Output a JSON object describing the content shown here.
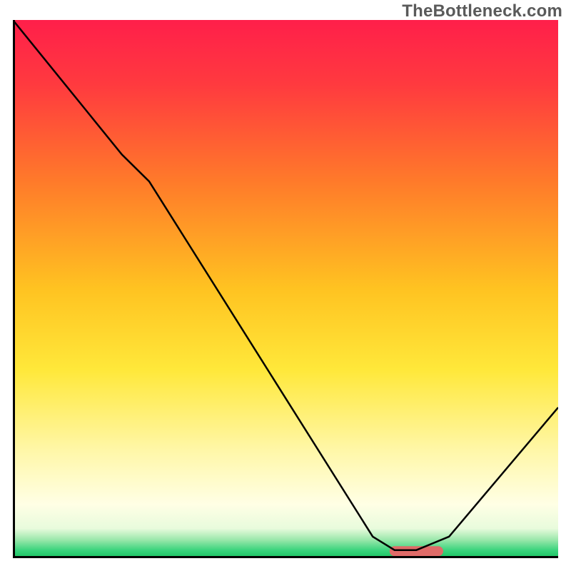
{
  "watermark": "TheBottleneck.com",
  "chart_data": {
    "type": "line",
    "title": "",
    "xlabel": "",
    "ylabel": "",
    "xlim": [
      0,
      100
    ],
    "ylim": [
      0,
      100
    ],
    "grid": false,
    "legend": null,
    "gradient_stops": [
      {
        "offset": 0.0,
        "color": "#ff1f4a"
      },
      {
        "offset": 0.12,
        "color": "#ff3a3f"
      },
      {
        "offset": 0.3,
        "color": "#ff7a2a"
      },
      {
        "offset": 0.5,
        "color": "#ffc321"
      },
      {
        "offset": 0.65,
        "color": "#ffe83a"
      },
      {
        "offset": 0.8,
        "color": "#fff7a8"
      },
      {
        "offset": 0.9,
        "color": "#ffffe5"
      },
      {
        "offset": 0.945,
        "color": "#e8fbdc"
      },
      {
        "offset": 0.965,
        "color": "#9ee8ad"
      },
      {
        "offset": 0.985,
        "color": "#3bd47d"
      },
      {
        "offset": 1.0,
        "color": "#18c261"
      }
    ],
    "series": [
      {
        "name": "bottleneck-curve",
        "color": "#000000",
        "width": 2.5,
        "points": [
          {
            "x": 0,
            "y": 100
          },
          {
            "x": 20,
            "y": 75
          },
          {
            "x": 25,
            "y": 70
          },
          {
            "x": 66,
            "y": 4
          },
          {
            "x": 70,
            "y": 1.5
          },
          {
            "x": 74,
            "y": 1.5
          },
          {
            "x": 80,
            "y": 4
          },
          {
            "x": 100,
            "y": 28
          }
        ]
      }
    ],
    "marker": {
      "name": "optimal-range",
      "color": "#df6b68",
      "x_start": 70,
      "x_end": 78,
      "y": 1.3,
      "thickness": 14
    }
  }
}
